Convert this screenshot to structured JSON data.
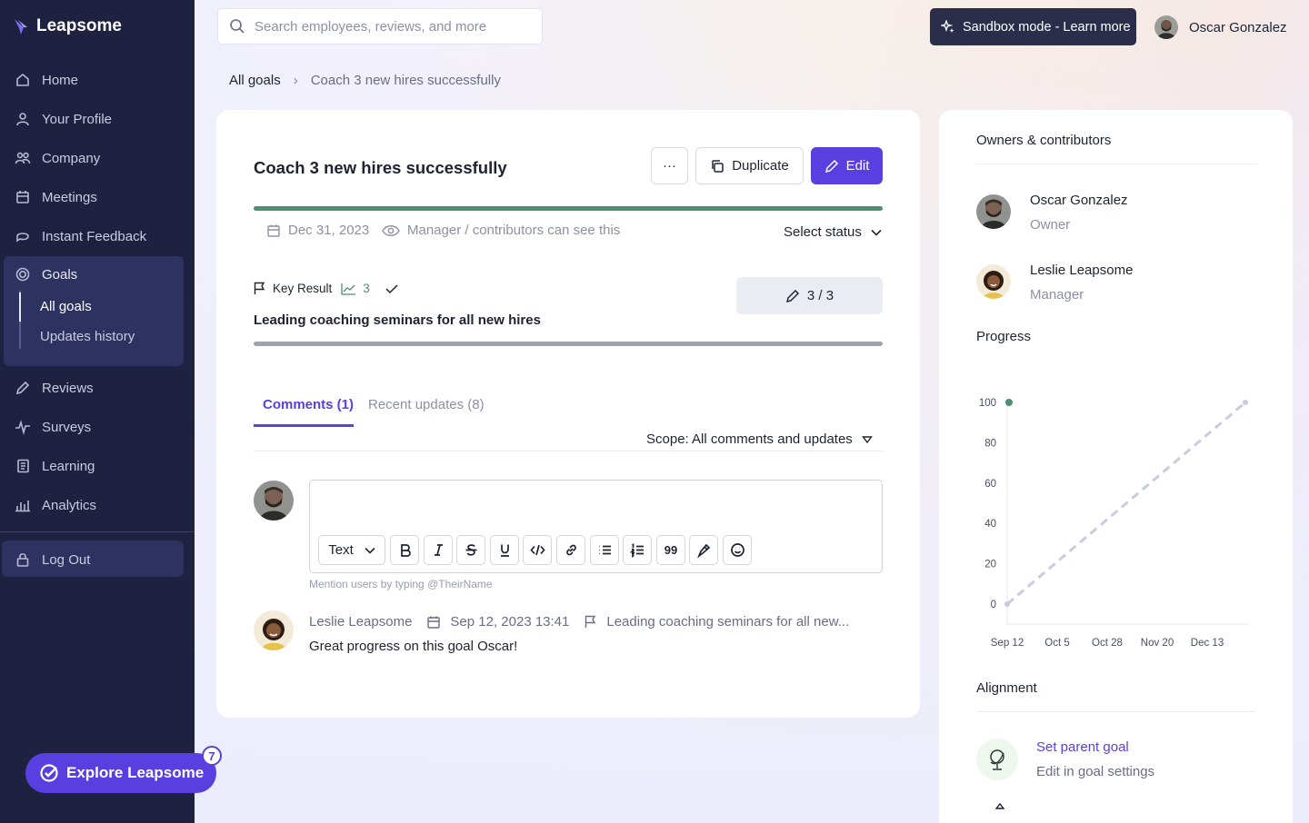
{
  "app": {
    "name": "Leapsome"
  },
  "sidebar": {
    "items": [
      {
        "label": "Home",
        "icon": "home-icon"
      },
      {
        "label": "Your Profile",
        "icon": "user-icon"
      },
      {
        "label": "Company",
        "icon": "people-icon"
      },
      {
        "label": "Meetings",
        "icon": "calendar-icon"
      },
      {
        "label": "Instant Feedback",
        "icon": "chat-icon"
      },
      {
        "label": "Goals",
        "icon": "target-icon"
      },
      {
        "label": "Reviews",
        "icon": "pen-icon"
      },
      {
        "label": "Surveys",
        "icon": "pulse-icon"
      },
      {
        "label": "Learning",
        "icon": "book-icon"
      },
      {
        "label": "Analytics",
        "icon": "bar-chart-icon"
      }
    ],
    "goals_sub": [
      "All goals",
      "Updates history"
    ],
    "logout": "Log Out",
    "explore": {
      "label": "Explore Leapsome",
      "badge": "7"
    }
  },
  "topbar": {
    "search_placeholder": "Search employees, reviews, and more",
    "sandbox": "Sandbox mode - Learn more",
    "user": "Oscar Gonzalez"
  },
  "breadcrumb": {
    "root": "All goals",
    "separator": "›",
    "current": "Coach 3 new hires successfully"
  },
  "goal": {
    "title": "Coach 3 new hires successfully",
    "more": "···",
    "duplicate": "Duplicate",
    "edit": "Edit",
    "date": "Dec 31, 2023",
    "visibility": "Manager / contributors can see this",
    "status": "Select status",
    "key_result": {
      "label": "Key Result",
      "count": "3",
      "title": "Leading coaching seminars for all new hires",
      "score": "3 / 3"
    }
  },
  "tabs": {
    "comments": "Comments (1)",
    "updates": "Recent updates (8)"
  },
  "scope": "Scope: All comments and updates",
  "editor": {
    "text_style": "Text",
    "quote": "99",
    "mention_hint": "Mention users by typing @TheirName"
  },
  "comment": {
    "author": "Leslie Leapsome",
    "date": "Sep 12, 2023 13:41",
    "key_result": "Leading coaching seminars for all new...",
    "text": "Great progress on this goal Oscar!"
  },
  "side": {
    "owners_title": "Owners & contributors",
    "people": [
      {
        "name": "Oscar Gonzalez",
        "role": "Owner"
      },
      {
        "name": "Leslie Leapsome",
        "role": "Manager"
      }
    ],
    "progress_title": "Progress",
    "alignment_title": "Alignment",
    "set_parent": "Set parent goal",
    "edit_in": "Edit in goal settings"
  },
  "chart_data": {
    "type": "line",
    "title": "Progress",
    "x_ticks": [
      "Sep 12",
      "Oct 5",
      "Oct 28",
      "Nov 20",
      "Dec 13"
    ],
    "y_ticks": [
      0,
      20,
      40,
      60,
      80,
      100
    ],
    "ylim": [
      0,
      100
    ],
    "series": [
      {
        "style": "actual",
        "points": [
          {
            "x": "2023-09-12",
            "y": 100
          }
        ],
        "color": "#4e8f72"
      },
      {
        "style": "target-dashed",
        "points": [
          {
            "x": "2023-09-12",
            "y": 0
          },
          {
            "x": "2023-12-31",
            "y": 100
          }
        ],
        "color": "#c9cbe0"
      }
    ]
  },
  "colors": {
    "accent": "#5a3fe0",
    "sidebar": "#1e2140",
    "success": "#4e8f72"
  }
}
